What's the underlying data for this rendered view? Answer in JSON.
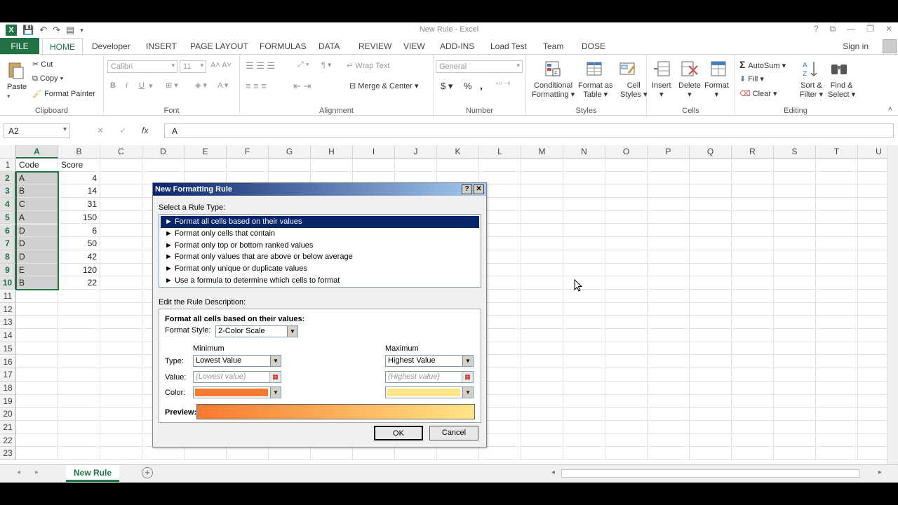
{
  "window": {
    "title": "New Rule - Excel",
    "signin": "Sign in",
    "controls": [
      "?",
      "⧉",
      "—",
      "❐",
      "✕"
    ]
  },
  "tabs": [
    "FILE",
    "HOME",
    "Developer",
    "INSERT",
    "PAGE LAYOUT",
    "FORMULAS",
    "DATA",
    "REVIEW",
    "VIEW",
    "ADD-INS",
    "Load Test",
    "Team",
    "DOSE"
  ],
  "ribbon": {
    "clipboard": {
      "label": "Clipboard",
      "paste": "Paste",
      "cut": "Cut",
      "copy": "Copy",
      "format_painter": "Format Painter"
    },
    "font": {
      "label": "Font",
      "font_name": "Calibri",
      "font_size": "11",
      "bold": "B",
      "italic": "I",
      "underline": "U"
    },
    "alignment": {
      "label": "Alignment",
      "wrap_text": "Wrap Text",
      "merge_center": "Merge & Center"
    },
    "number": {
      "label": "Number",
      "format": "General",
      "currency": "$",
      "percent": "%",
      "comma": ","
    },
    "styles": {
      "label": "Styles",
      "conditional": "Conditional",
      "conditional2": "Formatting",
      "format_as": "Format as",
      "format_as2": "Table",
      "cell": "Cell",
      "cell2": "Styles"
    },
    "cells": {
      "label": "Cells",
      "insert": "Insert",
      "delete": "Delete",
      "format": "Format"
    },
    "editing": {
      "label": "Editing",
      "autosum": "AutoSum",
      "fill": "Fill",
      "clear": "Clear",
      "sort": "Sort &",
      "sort2": "Filter",
      "find": "Find &",
      "find2": "Select"
    }
  },
  "formula_bar": {
    "name_box": "A2",
    "cancel": "✕",
    "enter": "✓",
    "fx": "fx",
    "value": "A"
  },
  "grid": {
    "columns": [
      "A",
      "B",
      "C",
      "D",
      "E",
      "F",
      "G",
      "H",
      "I",
      "J",
      "K",
      "L",
      "M",
      "N",
      "O",
      "P",
      "Q",
      "R",
      "S",
      "T",
      "U"
    ],
    "rows": [
      "1",
      "2",
      "3",
      "4",
      "5",
      "6",
      "7",
      "8",
      "9",
      "10",
      "11",
      "12",
      "13",
      "14",
      "15",
      "16",
      "17",
      "18",
      "19",
      "20",
      "21",
      "22",
      "23"
    ],
    "data": [
      [
        "Code",
        "Score"
      ],
      [
        "A",
        "4"
      ],
      [
        "B",
        "14"
      ],
      [
        "C",
        "31"
      ],
      [
        "A",
        "150"
      ],
      [
        "D",
        "6"
      ],
      [
        "D",
        "50"
      ],
      [
        "D",
        "42"
      ],
      [
        "E",
        "120"
      ],
      [
        "B",
        "22"
      ]
    ]
  },
  "sheet": {
    "tab": "New Rule",
    "add": "+"
  },
  "dialog": {
    "title": "New Formatting Rule",
    "help": "?",
    "close": "✕",
    "select_rule_type": "Select a Rule Type:",
    "rule_types": [
      "► Format all cells based on their values",
      "► Format only cells that contain",
      "► Format only top or bottom ranked values",
      "► Format only values that are above or below average",
      "► Format only unique or duplicate values",
      "► Use a formula to determine which cells to format"
    ],
    "edit_desc": "Edit the Rule Description:",
    "desc_heading": "Format all cells based on their values:",
    "format_style_label": "Format Style:",
    "format_style": "2-Color Scale",
    "minimum": "Minimum",
    "maximum": "Maximum",
    "type_label": "Type:",
    "value_label": "Value:",
    "color_label": "Color:",
    "min_type": "Lowest Value",
    "max_type": "Highest Value",
    "min_value": "(Lowest value)",
    "max_value": "(Highest value)",
    "min_color": "#f8792f",
    "max_color": "#fee687",
    "preview_label": "Preview:",
    "ok": "OK",
    "cancel": "Cancel"
  }
}
